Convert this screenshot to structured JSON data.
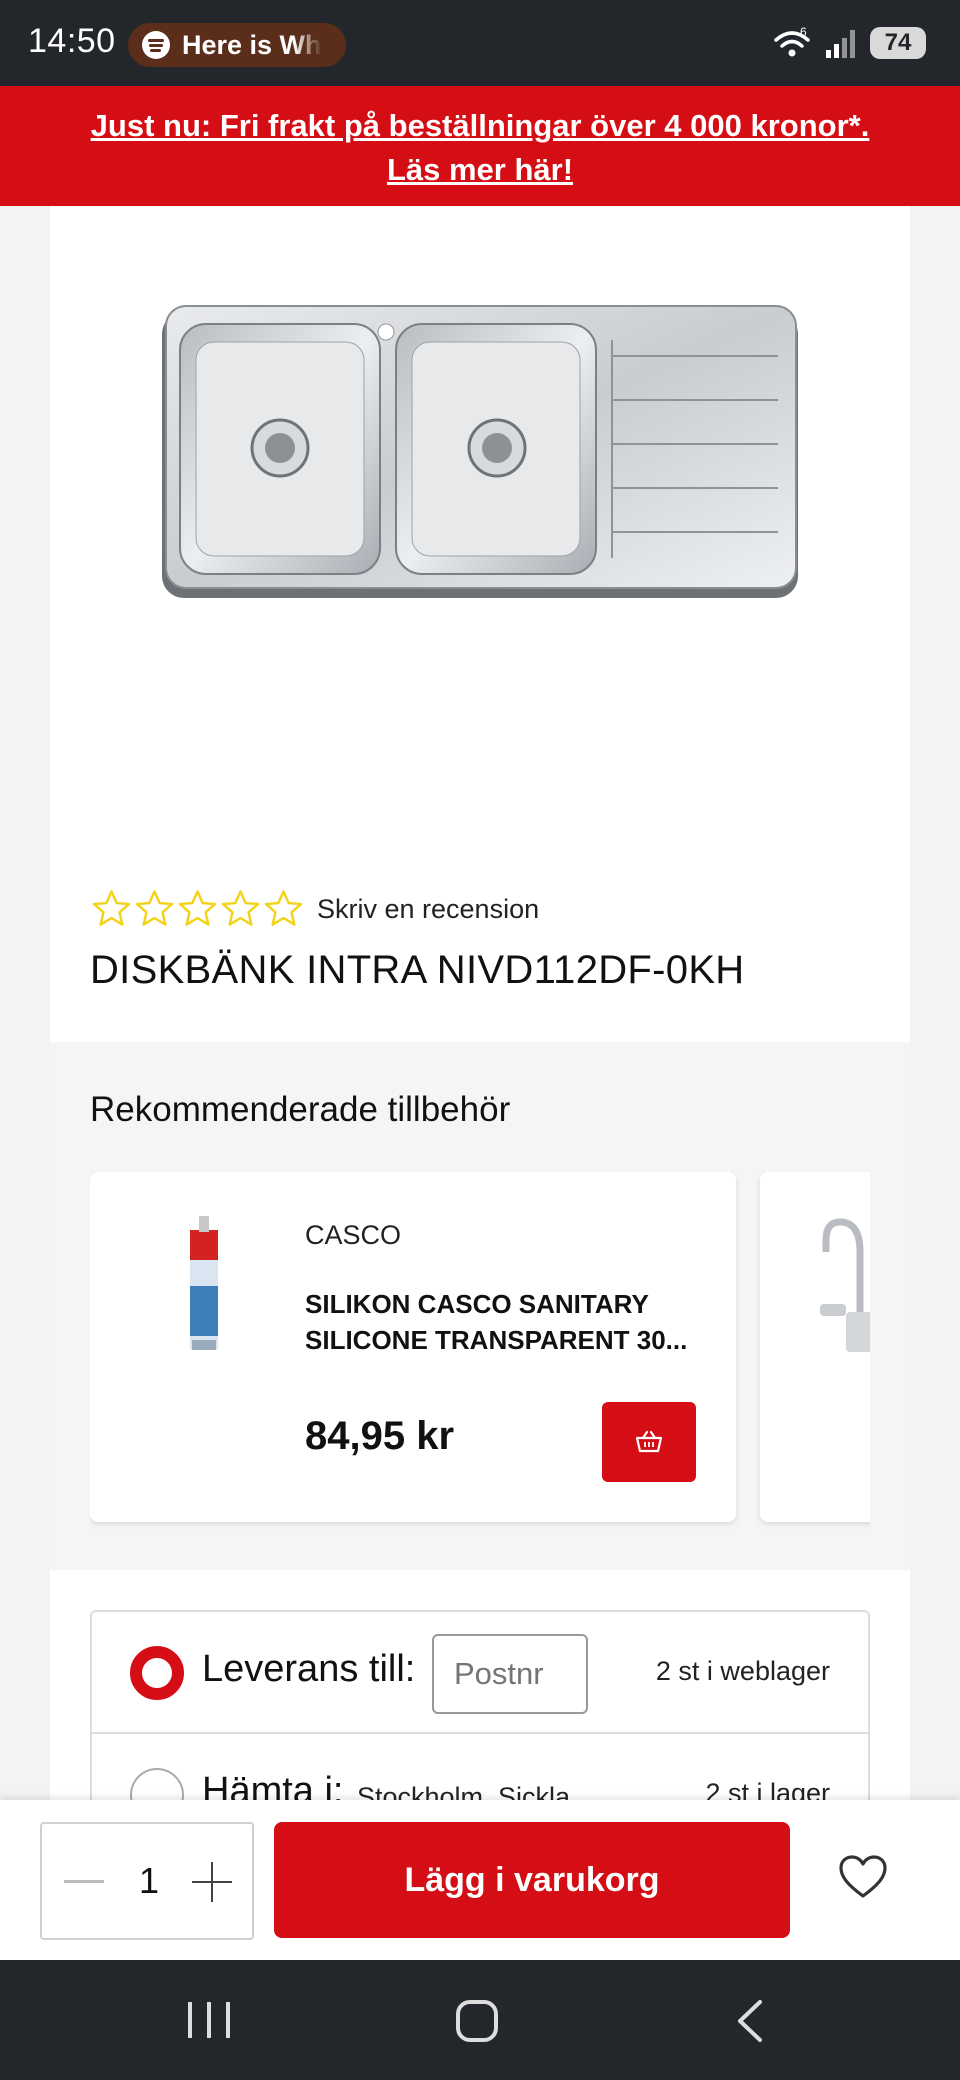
{
  "status_bar": {
    "time": "14:50",
    "media_text": "Here is Wh",
    "wifi_badge": "6",
    "battery": "74"
  },
  "promo": {
    "line1": "Just nu: Fri frakt på beställningar över 4 000 kronor*.",
    "line2": "Läs mer här!"
  },
  "product": {
    "rating_stars": 0,
    "rating_max": 5,
    "review_link": "Skriv en recension",
    "title": "DISKBÄNK INTRA NIVD112DF-0KH"
  },
  "recommended": {
    "title": "Rekommenderade tillbehör",
    "items": [
      {
        "brand": "CASCO",
        "name": "SILIKON CASCO SANITARY SILICONE TRANSPARENT 30...",
        "price": "84,95 kr",
        "image": "silicone-tube"
      },
      {
        "image": "faucet"
      }
    ]
  },
  "delivery": {
    "options": [
      {
        "label": "Leverans till:",
        "input_placeholder": "Postnr",
        "stock": "2 st i weblager",
        "selected": true
      },
      {
        "label": "Hämta i:",
        "store": "Stockholm, Sickla",
        "stock": "2 st i lager",
        "selected": false
      }
    ]
  },
  "cart_bar": {
    "quantity": "1",
    "add_to_cart": "Lägg i varukorg"
  },
  "colors": {
    "brand_red": "#d40e14",
    "star_yellow": "#f3d21a",
    "status_bar": "#23262b"
  }
}
